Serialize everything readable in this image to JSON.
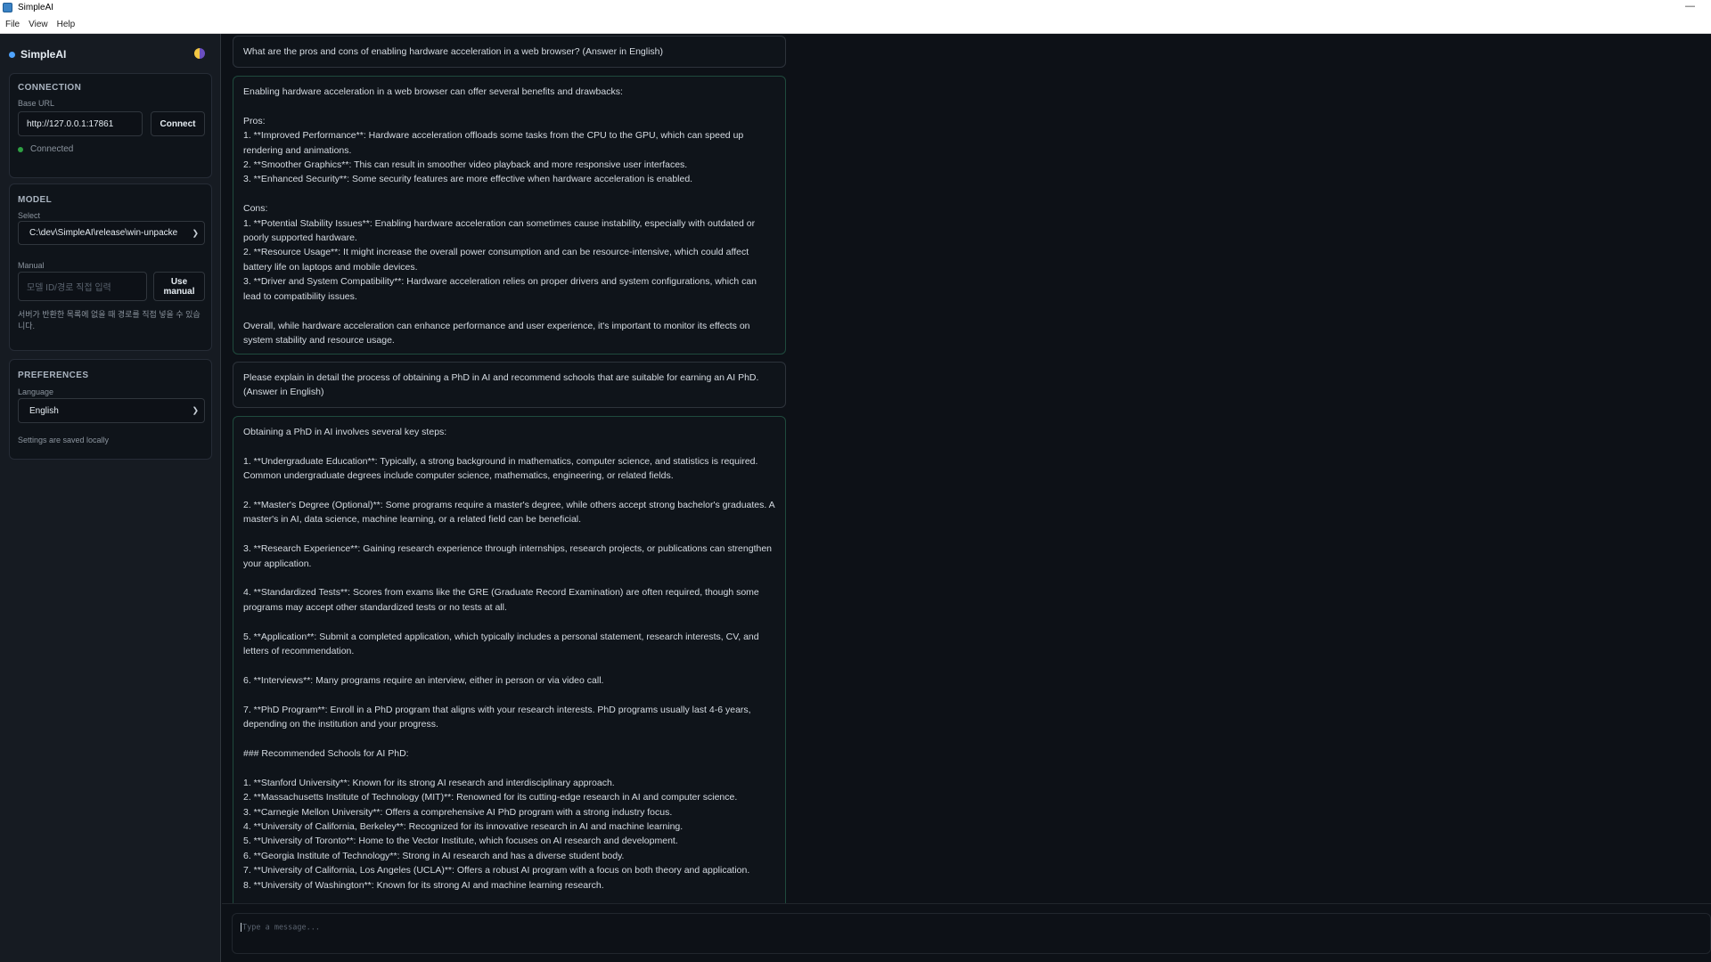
{
  "window": {
    "title": "SimpleAI"
  },
  "menu": [
    "File",
    "View",
    "Help"
  ],
  "sidebar": {
    "brand": "SimpleAI",
    "connection": {
      "title": "CONNECTION",
      "base_url_label": "Base URL",
      "base_url_value": "http://127.0.0.1:17861",
      "connect_button": "Connect",
      "status": "Connected",
      "status_color": "#2ea043"
    },
    "model": {
      "title": "MODEL",
      "select_label": "Select",
      "selected": "C:\\dev\\SimpleAI\\release\\win-unpacke",
      "manual_label": "Manual",
      "manual_placeholder": "모델 ID/경로 직접 입력",
      "use_manual_button": "Use manual",
      "hint": "서버가 반환한 목록에 없을 때 경로를 직접 넣을 수 있습니다."
    },
    "preferences": {
      "title": "PREFERENCES",
      "language_label": "Language",
      "language_value": "English",
      "saved_note": "Settings are saved locally"
    }
  },
  "messages": [
    {
      "role": "user",
      "text": "What are the pros and cons of enabling hardware acceleration in a web browser? (Answer in English)"
    },
    {
      "role": "assistant",
      "text": "Enabling hardware acceleration in a web browser can offer several benefits and drawbacks:\n\nPros:\n1. **Improved Performance**: Hardware acceleration offloads some tasks from the CPU to the GPU, which can speed up rendering and animations.\n2. **Smoother Graphics**: This can result in smoother video playback and more responsive user interfaces.\n3. **Enhanced Security**: Some security features are more effective when hardware acceleration is enabled.\n\nCons:\n1. **Potential Stability Issues**: Enabling hardware acceleration can sometimes cause instability, especially with outdated or poorly supported hardware.\n2. **Resource Usage**: It might increase the overall power consumption and can be resource-intensive, which could affect battery life on laptops and mobile devices.\n3. **Driver and System Compatibility**: Hardware acceleration relies on proper drivers and system configurations, which can lead to compatibility issues.\n\nOverall, while hardware acceleration can enhance performance and user experience, it's important to monitor its effects on system stability and resource usage."
    },
    {
      "role": "user",
      "text": "Please explain in detail the process of obtaining a PhD in AI and recommend schools that are suitable for earning an AI PhD. (Answer in English)"
    },
    {
      "role": "assistant",
      "text": "Obtaining a PhD in AI involves several key steps:\n\n1. **Undergraduate Education**: Typically, a strong background in mathematics, computer science, and statistics is required. Common undergraduate degrees include computer science, mathematics, engineering, or related fields.\n\n2. **Master's Degree (Optional)**: Some programs require a master's degree, while others accept strong bachelor's graduates. A master's in AI, data science, machine learning, or a related field can be beneficial.\n\n3. **Research Experience**: Gaining research experience through internships, research projects, or publications can strengthen your application.\n\n4. **Standardized Tests**: Scores from exams like the GRE (Graduate Record Examination) are often required, though some programs may accept other standardized tests or no tests at all.\n\n5. **Application**: Submit a completed application, which typically includes a personal statement, research interests, CV, and letters of recommendation.\n\n6. **Interviews**: Many programs require an interview, either in person or via video call.\n\n7. **PhD Program**: Enroll in a PhD program that aligns with your research interests. PhD programs usually last 4-6 years, depending on the institution and your progress.\n\n### Recommended Schools for AI PhD:\n\n1. **Stanford University**: Known for its strong AI research and interdisciplinary approach.\n2. **Massachusetts Institute of Technology (MIT)**: Renowned for its cutting-edge research in AI and computer science.\n3. **Carnegie Mellon University**: Offers a comprehensive AI PhD program with a strong industry focus.\n4. **University of California, Berkeley**: Recognized for its innovative research in AI and machine learning.\n5. **University of Toronto**: Home to the Vector Institute, which focuses on AI research and development.\n6. **Georgia Institute of Technology**: Strong in AI research and has a diverse student body.\n7. **University of California, Los Angeles (UCLA)**: Offers a robust AI program with a focus on both theory and application.\n8. **University of Washington**: Known for its strong AI and machine learning research."
    }
  ],
  "composer": {
    "placeholder": "Type a message..."
  }
}
